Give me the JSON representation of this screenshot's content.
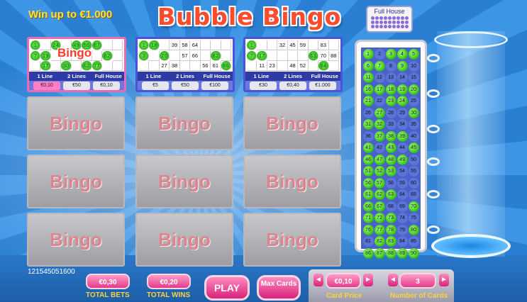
{
  "header": {
    "win_text": "Win up to €1.000",
    "logo": "Bubble Bingo",
    "full_house_icon_label": "Full House"
  },
  "cards": [
    {
      "bingo_badge": "Bingo",
      "rows": [
        [
          "1",
          "",
          "24",
          "",
          "49",
          "56",
          "67",
          "",
          ""
        ],
        [
          "7",
          "19",
          "",
          "",
          "",
          "",
          "",
          "82",
          ""
        ],
        [
          "",
          "17",
          "",
          "30",
          "",
          "62",
          "77",
          "",
          ""
        ]
      ],
      "marked": [
        0,
        2,
        4,
        5,
        6,
        9,
        10,
        16,
        19,
        20,
        21,
        23,
        24,
        25
      ],
      "prizes": [
        "1 Line",
        "2 Lines",
        "Full House"
      ],
      "prices": [
        "€0,10",
        "€50",
        "€0,10"
      ]
    },
    {
      "rows": [
        [
          "1",
          "18",
          "",
          "39",
          "58",
          "64",
          "",
          "",
          ""
        ],
        [
          "3",
          "",
          "20",
          "",
          "57",
          "66",
          "",
          "82",
          ""
        ],
        [
          "",
          "",
          "27",
          "38",
          "",
          "",
          "56",
          "61",
          "86"
        ]
      ],
      "marked": [
        0,
        1,
        9,
        11,
        16,
        22,
        26
      ],
      "prizes": [
        "1 Line",
        "2 Lines",
        "Full House"
      ],
      "prices": [
        "€5",
        "€50",
        "€100"
      ]
    },
    {
      "rows": [
        [
          "1",
          "",
          "",
          "32",
          "45",
          "59",
          "",
          "83",
          ""
        ],
        [
          "7",
          "17",
          "",
          "",
          "",
          "",
          "63",
          "70",
          "88"
        ],
        [
          "",
          "11",
          "23",
          "",
          "48",
          "52",
          "",
          "84",
          ""
        ]
      ],
      "marked": [
        0,
        9,
        10,
        15,
        24,
        25
      ],
      "prizes": [
        "1 Line",
        "2 Lines",
        "Full House"
      ],
      "prices": [
        "€30",
        "€0,40",
        "€1.000"
      ]
    }
  ],
  "empty_slot_label": "Bingo",
  "board": {
    "numbers": [
      "1",
      "2",
      "3",
      "4",
      "5",
      "6",
      "7",
      "8",
      "9",
      "10",
      "11",
      "12",
      "13",
      "14",
      "15",
      "16",
      "17",
      "18",
      "19",
      "20",
      "21",
      "22",
      "23",
      "24",
      "25",
      "26",
      "27",
      "28",
      "29",
      "30",
      "31",
      "32",
      "33",
      "34",
      "35",
      "36",
      "37",
      "38",
      "39",
      "40",
      "41",
      "42",
      "43",
      "44",
      "45",
      "46",
      "47",
      "48",
      "49",
      "50",
      "51",
      "52",
      "53",
      "54",
      "55",
      "56",
      "57",
      "58",
      "59",
      "60",
      "61",
      "62",
      "63",
      "64",
      "65",
      "66",
      "67",
      "68",
      "69",
      "70",
      "71",
      "72",
      "73",
      "74",
      "75",
      "76",
      "77",
      "78",
      "79",
      "80",
      "81",
      "82",
      "83",
      "84",
      "85",
      "86",
      "87",
      "88",
      "89",
      "90"
    ],
    "drawn": [
      1,
      3,
      4,
      5,
      6,
      7,
      9,
      11,
      16,
      17,
      18,
      19,
      20,
      21,
      23,
      24,
      27,
      30,
      31,
      32,
      37,
      38,
      39,
      41,
      43,
      45,
      46,
      47,
      48,
      49,
      51,
      52,
      53,
      56,
      57,
      61,
      62,
      63,
      66,
      67,
      70,
      71,
      72,
      73,
      76,
      77,
      78,
      80,
      82,
      83,
      86,
      87,
      88,
      89,
      90
    ]
  },
  "footer": {
    "session_id": "121545051600",
    "total_bets_value": "€0,30",
    "total_bets_label": "TOTAL BETS",
    "total_wins_value": "€0,20",
    "total_wins_label": "TOTAL WINS",
    "play_label": "PLAY",
    "max_cards_label": "Max Cards",
    "card_price_value": "€0,10",
    "card_price_label": "Card Price",
    "number_of_cards_value": "3",
    "number_of_cards_label": "Number of Cards",
    "arrow_left": "◄",
    "arrow_right": "►"
  },
  "colors": {
    "accent_pink": "#e33c89",
    "logo_red": "#ff4a2c",
    "marked_green": "#38c21c",
    "label_yellow": "#ffd23a"
  }
}
